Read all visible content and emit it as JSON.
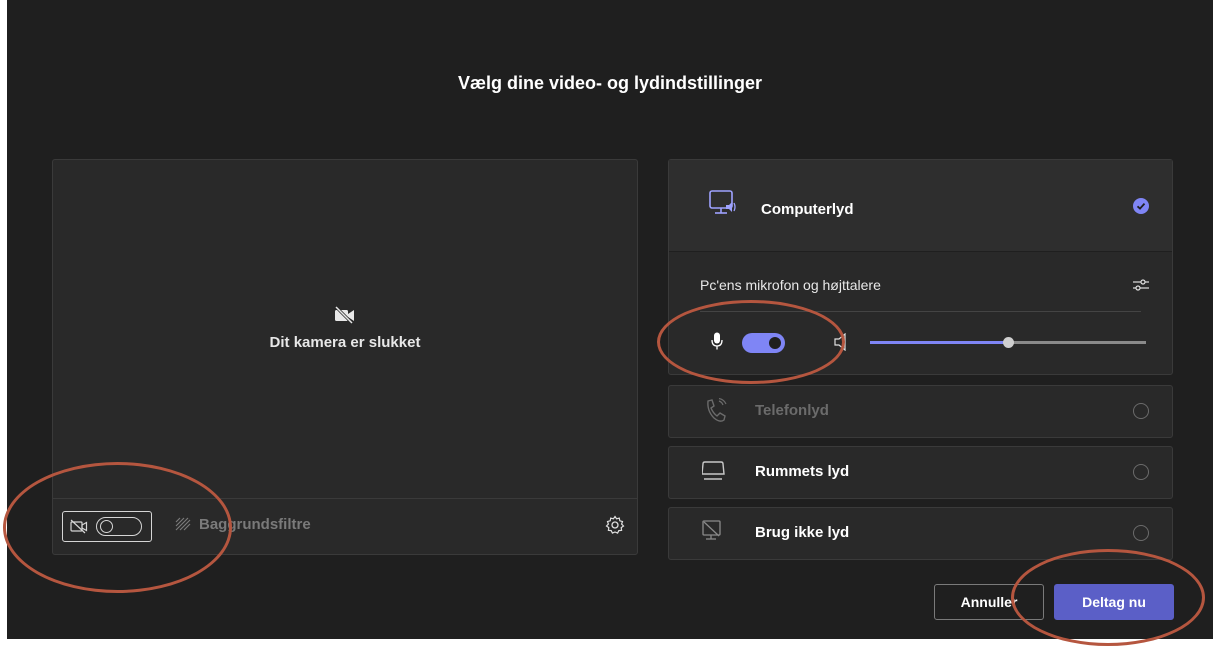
{
  "dialog": {
    "title": "Vælg dine video- og lydindstillinger"
  },
  "camera": {
    "off_label": "Dit kamera er slukket",
    "background_filters_label": "Baggrundsfiltre",
    "video_toggle_on": false
  },
  "audio": {
    "computer_audio": {
      "label": "Computerlyd",
      "selected": true,
      "device_label": "Pc'ens mikrofon og højttalere",
      "mic_on": true,
      "speaker_volume": 0.5
    },
    "options": [
      {
        "label": "Telefonlyd",
        "icon": "phone-audio-icon",
        "disabled": true
      },
      {
        "label": "Rummets lyd",
        "icon": "room-audio-icon",
        "disabled": false
      },
      {
        "label": "Brug ikke lyd",
        "icon": "no-audio-icon",
        "disabled": false
      }
    ]
  },
  "buttons": {
    "cancel_label": "Annuller",
    "join_label": "Deltag nu"
  },
  "colors": {
    "accent": "#7f85f5",
    "primary_button": "#5b5fc7",
    "background": "#1f1f1f",
    "annotation": "#b5563f"
  }
}
